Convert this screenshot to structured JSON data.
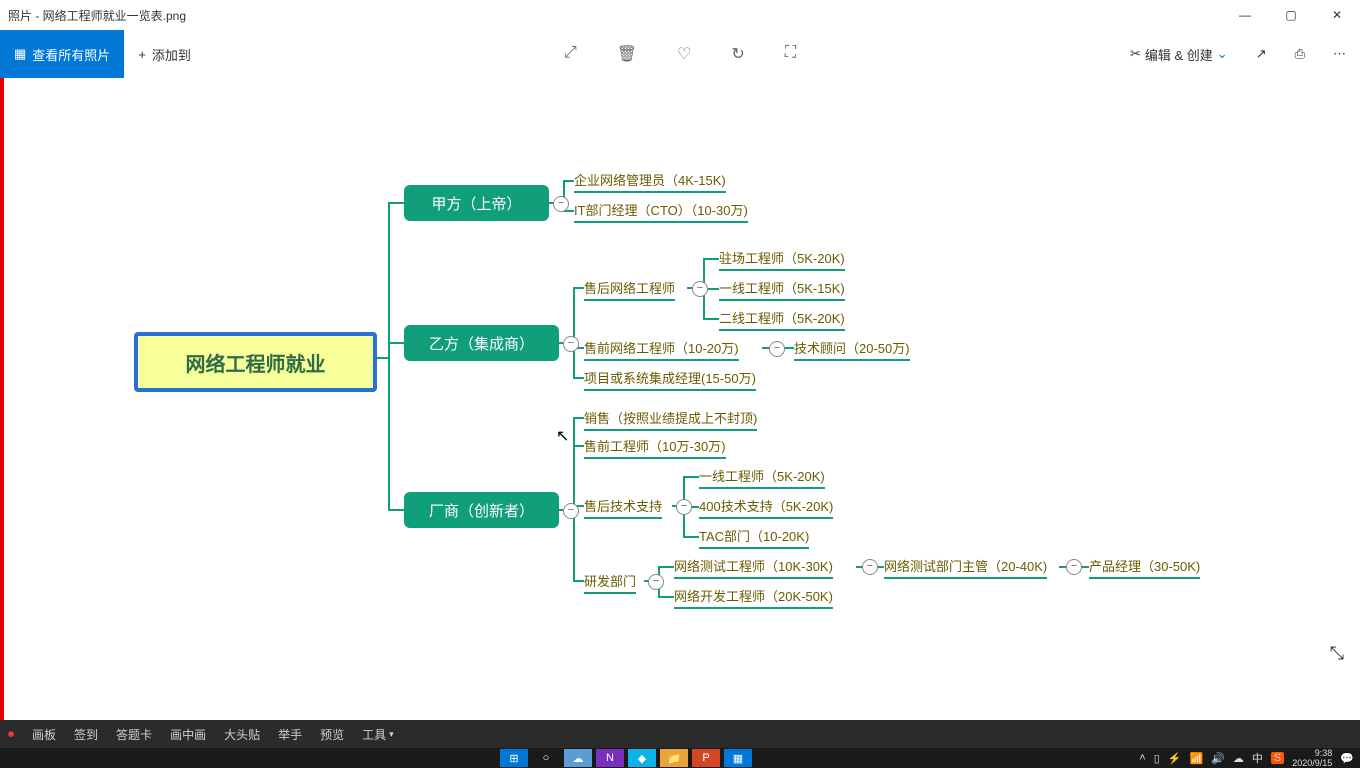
{
  "window": {
    "title": "照片 - 网络工程师就业一览表.png"
  },
  "toolbar": {
    "all_photos": "查看所有照片",
    "add_to": "添加到",
    "edit_create": "编辑 & 创建"
  },
  "mindmap": {
    "root": "网络工程师就业",
    "b1": {
      "title": "甲方（上帝）",
      "items": [
        "企业网络管理员（4K-15K)",
        "IT部门经理（CTO）（10-30万)"
      ]
    },
    "b2": {
      "title": "乙方（集成商）",
      "items": {
        "after_sale": "售后网络工程师",
        "after_children": [
          "驻场工程师（5K-20K)",
          "一线工程师（5K-15K)",
          "二线工程师（5K-20K)"
        ],
        "pre_sale": "售前网络工程师（10-20万)",
        "pre_child": "技术顾问（20-50万)",
        "pm": "项目或系统集成经理(15-50万)"
      }
    },
    "b3": {
      "title": "厂商（创新者）",
      "items": {
        "sales": "销售（按照业绩提成上不封顶)",
        "pre_eng": "售前工程师（10万-30万)",
        "support": "售后技术支持",
        "support_children": [
          "一线工程师（5K-20K)",
          "400技术支持（5K-20K)",
          "TAC部门（10-20K)"
        ],
        "rd": "研发部门",
        "rd_children": [
          "网络测试工程师（10K-30K)",
          "网络开发工程师（20K-50K)"
        ],
        "rd_chain": [
          "网络测试部门主管（20-40K)",
          "产品经理（30-50K)"
        ]
      }
    }
  },
  "tabs": [
    "画板",
    "签到",
    "答题卡",
    "画中画",
    "大头贴",
    "举手",
    "预览",
    "工具"
  ],
  "tray": {
    "time": "9:38",
    "date": "2020/9/15",
    "ime": "中"
  }
}
